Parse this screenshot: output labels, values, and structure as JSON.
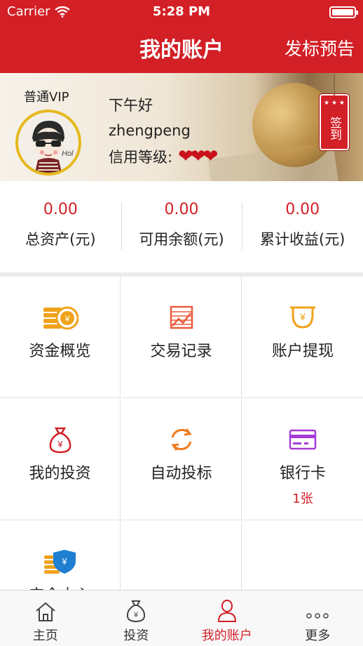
{
  "status": {
    "carrier": "Carrier",
    "time": "5:28 PM"
  },
  "nav": {
    "title": "我的账户",
    "right_action": "发标预告"
  },
  "banner": {
    "vip_level": "普通VIP",
    "greeting": "下午好",
    "username": "zhengpeng",
    "credit_label": "信用等级:",
    "credit_hearts": "❤❤❤",
    "avatar_text": "Hol",
    "checkin_label": "签到",
    "checkin_stars": "★ ★ ★"
  },
  "stats": [
    {
      "value": "0.00",
      "label": "总资产(元)"
    },
    {
      "value": "0.00",
      "label": "可用余额(元)"
    },
    {
      "value": "0.00",
      "label": "累计收益(元)"
    }
  ],
  "grid": [
    {
      "label": "资金概览",
      "icon": "coins-icon"
    },
    {
      "label": "交易记录",
      "icon": "record-chart-icon"
    },
    {
      "label": "账户提现",
      "icon": "withdraw-icon"
    },
    {
      "label": "我的投资",
      "icon": "money-bag-icon"
    },
    {
      "label": "自动投标",
      "icon": "refresh-icon"
    },
    {
      "label": "银行卡",
      "icon": "bank-card-icon",
      "sub": "1张"
    },
    {
      "label": "安全中心",
      "icon": "security-shield-icon"
    }
  ],
  "tabs": [
    {
      "label": "主页",
      "icon": "home-icon"
    },
    {
      "label": "投资",
      "icon": "money-bag-icon"
    },
    {
      "label": "我的账户",
      "icon": "user-icon",
      "active": true
    },
    {
      "label": "更多",
      "icon": "more-dots-icon"
    }
  ],
  "colors": {
    "brand_red": "#d31f26",
    "gold": "#f0a21a",
    "purple": "#a53bd6",
    "orange": "#f07b1e"
  }
}
